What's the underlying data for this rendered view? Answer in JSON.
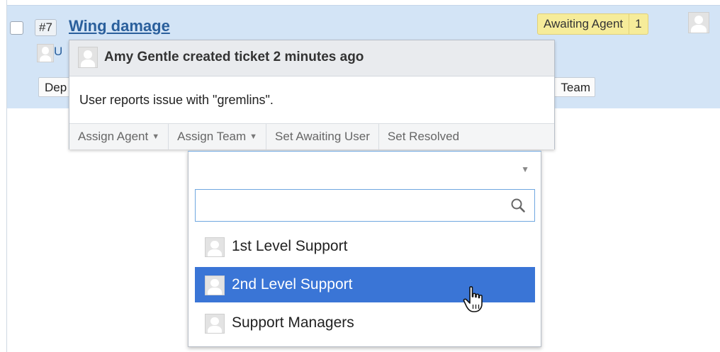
{
  "ticket": {
    "id": "#7",
    "title": "Wing damage",
    "status": "Awaiting Agent",
    "status_count": "1",
    "line2_initial": "U",
    "dept_chip": "Dep",
    "team_chip": "Team"
  },
  "popover": {
    "title": "Amy Gentle created ticket 2 minutes ago",
    "body": "User reports issue with \"gremlins\".",
    "actions": {
      "assign_agent": "Assign Agent",
      "assign_team": "Assign Team",
      "set_awaiting_user": "Set Awaiting User",
      "set_resolved": "Set Resolved"
    }
  },
  "dropdown": {
    "search_value": "",
    "options": [
      {
        "label": "1st Level Support"
      },
      {
        "label": "2nd Level Support"
      },
      {
        "label": "Support Managers"
      }
    ]
  },
  "colors": {
    "row_highlight": "#d3e4f6",
    "link": "#2a5f9c",
    "status_badge": "#f6ec9a",
    "selected_option": "#3a75d6",
    "focus_border": "#6fa7e0"
  }
}
